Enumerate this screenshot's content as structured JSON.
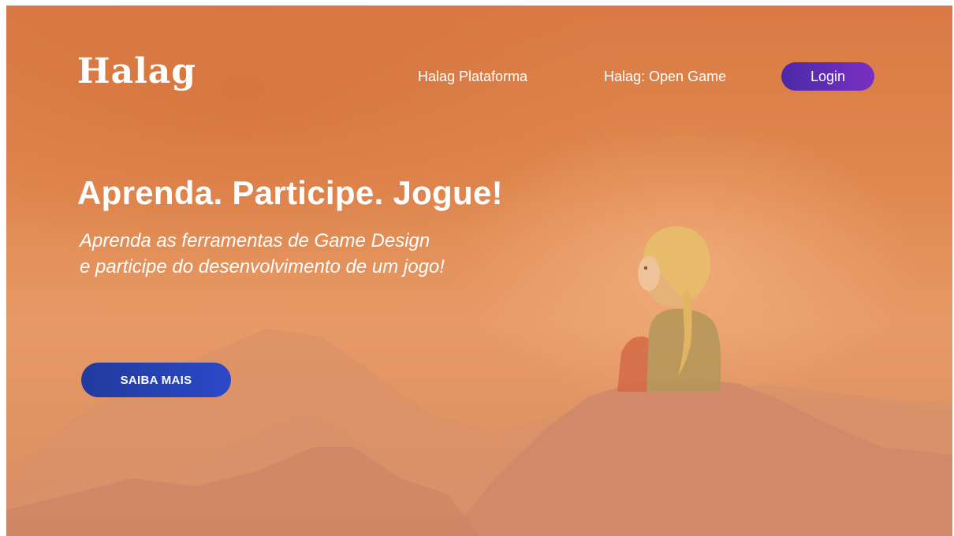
{
  "nav": {
    "logo": "Halag",
    "links": [
      "Halag Plataforma",
      "Halag: Open Game"
    ],
    "login_label": "Login"
  },
  "hero": {
    "title": "Aprenda. Participe. Jogue!",
    "subtitle_lines": [
      "Aprenda as ferramentas de Game Design",
      "e participe do desenvolvimento de um jogo!"
    ],
    "cta_label": "SAIBA MAIS"
  },
  "colors": {
    "background": "#e08850",
    "login_button": "#5a2cb4",
    "cta_button": "#2540b0",
    "text": "#ffffff"
  }
}
